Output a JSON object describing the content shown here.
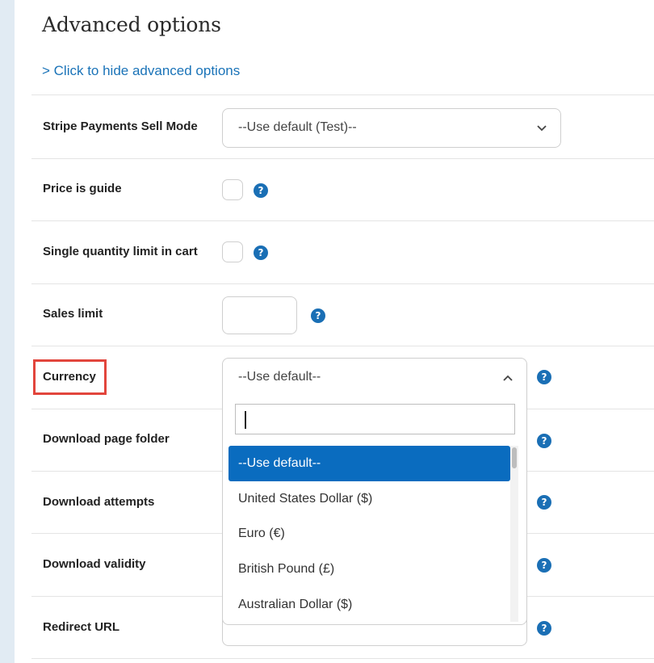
{
  "page": {
    "title": "Advanced options",
    "toggle_link": "> Click to hide advanced options"
  },
  "fields": {
    "sell_mode": {
      "label": "Stripe Payments Sell Mode",
      "value": "--Use default (Test)--"
    },
    "price_guide": {
      "label": "Price is guide",
      "checked": false
    },
    "single_qty": {
      "label": "Single quantity limit in cart",
      "checked": false
    },
    "sales_limit": {
      "label": "Sales limit",
      "value": ""
    },
    "currency": {
      "label": "Currency",
      "value": "--Use default--",
      "search_value": "",
      "options": [
        "--Use default--",
        "United States Dollar ($)",
        "Euro (€)",
        "British Pound (£)",
        "Australian Dollar ($)"
      ],
      "selected_index": 0
    },
    "download_folder": {
      "label": "Download page folder"
    },
    "download_attempts": {
      "label": "Download attempts"
    },
    "download_validity": {
      "label": "Download validity"
    },
    "redirect_url": {
      "label": "Redirect URL"
    }
  },
  "help_icon_glyph": "?",
  "colors": {
    "link": "#1a73b8",
    "help_icon": "#1a6fb5",
    "selected_option": "#0a6cbf",
    "highlight_box": "#e2453c",
    "side_strip": "#e1ebf3"
  }
}
